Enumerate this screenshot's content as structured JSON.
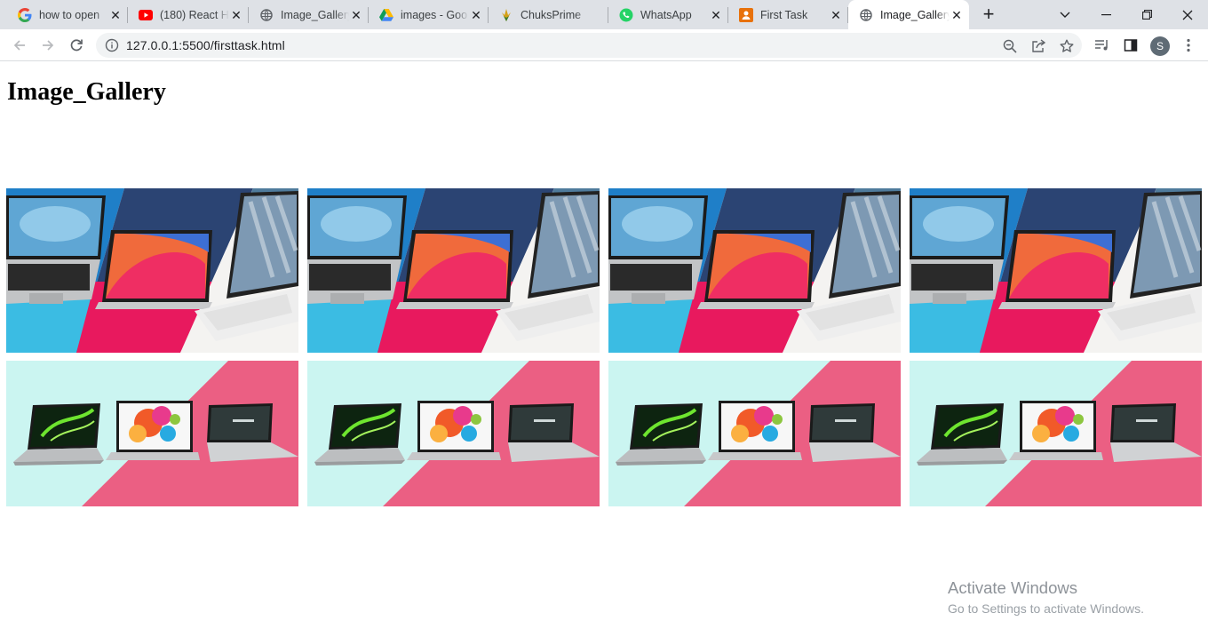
{
  "browser": {
    "tabs": [
      {
        "title": "how to open",
        "icon": "google-icon"
      },
      {
        "title": "(180) React H",
        "icon": "youtube-icon"
      },
      {
        "title": "Image_Gallery",
        "icon": "globe-icon"
      },
      {
        "title": "images - Goo",
        "icon": "google-drive-icon"
      },
      {
        "title": "ChuksPrime",
        "icon": "chuksprime-icon"
      },
      {
        "title": "WhatsApp",
        "icon": "whatsapp-icon"
      },
      {
        "title": "First Task",
        "icon": "first-task-icon"
      },
      {
        "title": "Image_Gallery",
        "icon": "globe-icon",
        "active": true
      }
    ],
    "url": "127.0.0.1:5500/firsttask.html",
    "profile_initial": "S",
    "accent": "#1a73e8"
  },
  "page": {
    "heading": "Image_Gallery",
    "gallery": {
      "rows": [
        {
          "image": "laptops-collage-blue-pink",
          "count": 4
        },
        {
          "image": "laptops-collage-mint-pink",
          "count": 4
        }
      ]
    }
  },
  "watermark": {
    "line1": "Activate Windows",
    "line2": "Go to Settings to activate Windows."
  }
}
